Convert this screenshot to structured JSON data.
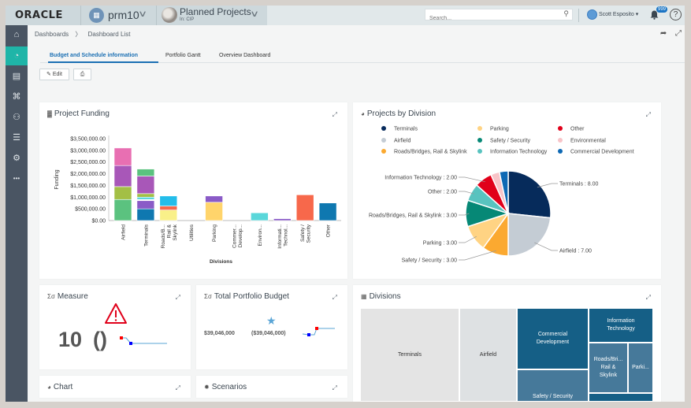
{
  "header": {
    "logo": "ORACLE",
    "workspace": "prm10",
    "project_title": "Planned Projects",
    "project_subtitle": "In: CIP",
    "search_placeholder": "Search...",
    "user_name": "Scott Esposito ▾",
    "notification_count": "999",
    "help_label": "?"
  },
  "sidebar": {
    "items": [
      {
        "name": "home",
        "glyph": "⌂"
      },
      {
        "name": "dashboards",
        "glyph": "◔",
        "active": true
      },
      {
        "name": "projects",
        "glyph": "▤"
      },
      {
        "name": "company",
        "glyph": "⌘"
      },
      {
        "name": "users",
        "glyph": "⚇"
      },
      {
        "name": "documents",
        "glyph": "☰"
      },
      {
        "name": "settings",
        "glyph": "⚙"
      },
      {
        "name": "more",
        "glyph": "•••"
      }
    ]
  },
  "breadcrumb": {
    "items": [
      "Dashboards",
      "〉",
      "Dashboard List"
    ]
  },
  "tabs": [
    {
      "label": "Budget and Schedule information",
      "active": true
    },
    {
      "label": "Portfolio Gantt",
      "active": false
    },
    {
      "label": "Overview Dashboard",
      "active": false
    }
  ],
  "toolbar": {
    "edit_label": "Edit",
    "edit_icon": "✎",
    "print_icon": "⎙"
  },
  "expand_glyph": "⤢",
  "cards": {
    "project_funding": {
      "title": "Project Funding",
      "icon": "▓"
    },
    "projects_by_division": {
      "title": "Projects by Division",
      "icon": "◕"
    },
    "measure": {
      "title": "Measure",
      "icon": "Σσ",
      "value": "10",
      "paren": "()",
      "alert_icon": "⚠"
    },
    "total_portfolio_budget": {
      "title": "Total Portfolio Budget",
      "icon": "Σσ",
      "value": "$39,046,000",
      "variance": "($39,046,000)",
      "star_icon": "★"
    },
    "divisions": {
      "title": "Divisions",
      "icon": "▦"
    },
    "chart": {
      "title": "Chart",
      "icon": "◕"
    },
    "scenarios": {
      "title": "Scenarios",
      "icon": "✹"
    }
  },
  "chart_data": [
    {
      "type": "bar",
      "stacked": true,
      "title": "Project Funding",
      "xlabel": "Divisions",
      "ylabel": "Funding",
      "ylim": [
        0,
        3500000
      ],
      "yticks": [
        "$0.00",
        "$500,000.00",
        "$1,000,000.00",
        "$1,500,000.00",
        "$2,000,000.00",
        "$2,500,000.00",
        "$3,000,000.00",
        "$3,500,000.00"
      ],
      "categories": [
        "Airfield",
        "Terminals",
        "Roads/B... Rail & Skylink",
        "Utilities",
        "Parking",
        "Commer... Develop...",
        "Environ...",
        "Informati... Technol...",
        "Safety / Security",
        "Other"
      ],
      "category_lines": [
        [
          "Airfield"
        ],
        [
          "Terminals"
        ],
        [
          "Roads/B...",
          "Rail &",
          "Skylink"
        ],
        [
          "Utilities"
        ],
        [
          "Parking"
        ],
        [
          "Commer...",
          "Develop..."
        ],
        [
          "Environ..."
        ],
        [
          "Informati...",
          "Technol..."
        ],
        [
          "Safety /",
          "Security"
        ],
        [
          "Other"
        ]
      ],
      "stacks": [
        [
          {
            "value": 900000,
            "color": "#5bc27f"
          },
          {
            "value": 550000,
            "color": "#a3bf45"
          },
          {
            "value": 900000,
            "color": "#a857b8"
          },
          {
            "value": 750000,
            "color": "#e86fb2"
          }
        ],
        [
          {
            "value": 500000,
            "color": "#0f78b0"
          },
          {
            "value": 350000,
            "color": "#8a5bc7"
          },
          {
            "value": 50000,
            "color": "#ffffff"
          },
          {
            "value": 100000,
            "color": "#5ad7da"
          },
          {
            "value": 150000,
            "color": "#a3bf45"
          },
          {
            "value": 750000,
            "color": "#a857b8"
          },
          {
            "value": 300000,
            "color": "#5bc27f"
          }
        ],
        [
          {
            "value": 450000,
            "color": "#f9f089"
          },
          {
            "value": 170000,
            "color": "#f7684b"
          },
          {
            "value": 430000,
            "color": "#24bdea"
          }
        ],
        [],
        [
          {
            "value": 780000,
            "color": "#ffd46b"
          },
          {
            "value": 270000,
            "color": "#8a5bc7"
          }
        ],
        [],
        [
          {
            "value": 330000,
            "color": "#5ad7da"
          }
        ],
        [
          {
            "value": 80000,
            "color": "#8a5bc7"
          }
        ],
        [
          {
            "value": 1100000,
            "color": "#f7684b"
          }
        ],
        [
          {
            "value": 750000,
            "color": "#0f78b0"
          }
        ]
      ]
    },
    {
      "type": "pie",
      "title": "Projects by Division",
      "legend_position": "top",
      "legend": [
        {
          "label": "Terminals",
          "color": "#072b5c"
        },
        {
          "label": "Airfield",
          "color": "#c4ccd4"
        },
        {
          "label": "Roads/Bridges, Rail & Skylink",
          "color": "#fba930"
        },
        {
          "label": "Parking",
          "color": "#ffd383"
        },
        {
          "label": "Safety / Security",
          "color": "#068876"
        },
        {
          "label": "Information Technology",
          "color": "#58c3bf"
        },
        {
          "label": "Other",
          "color": "#e1001a"
        },
        {
          "label": "Environmental",
          "color": "#f8c4c8"
        },
        {
          "label": "Commercial Development",
          "color": "#0e69b4"
        }
      ],
      "slices": [
        {
          "label": "Terminals",
          "value": 8,
          "color": "#062b5b",
          "display": "Terminals : 8.00"
        },
        {
          "label": "Airfield",
          "value": 7,
          "color": "#c4ccd4",
          "display": "Airfield : 7.00"
        },
        {
          "label": "Safety / Security",
          "value": 3,
          "color": "#fba930",
          "display": "Safety / Security : 3.00"
        },
        {
          "label": "Parking",
          "value": 3,
          "color": "#ffd383",
          "display": "Parking : 3.00"
        },
        {
          "label": "Roads/Bridges, Rail & Skylink",
          "value": 3,
          "color": "#068876",
          "display": "Roads/Bridges, Rail & Skylink : 3.00"
        },
        {
          "label": "Other",
          "value": 2,
          "color": "#58c3bf",
          "display": "Other : 2.00"
        },
        {
          "label": "Information Technology",
          "value": 2,
          "color": "#e1001a",
          "display": "Information Technology : 2.00"
        },
        {
          "label": "Environmental",
          "value": 1,
          "color": "#f8c4c8",
          "display": ""
        },
        {
          "label": "Commercial Development",
          "value": 1,
          "color": "#0e69b4",
          "display": ""
        }
      ]
    },
    {
      "type": "treemap",
      "title": "Divisions",
      "cells": [
        {
          "label": "Terminals",
          "color": "#e4e4e4",
          "text": "#333333"
        },
        {
          "label": "Airfield",
          "color": "#dee1e3",
          "text": "#333333"
        },
        {
          "label": "Commercial Development",
          "color": "#155f86",
          "text": "#ffffff"
        },
        {
          "label": "Safety / Security",
          "color": "#46799a",
          "text": "#ffffff"
        },
        {
          "label": "Information Technology",
          "color": "#155f86",
          "text": "#ffffff"
        },
        {
          "label": "Roads/Bri... Rail & Skylink",
          "color": "#46799a",
          "text": "#ffffff"
        },
        {
          "label": "Parki...",
          "color": "#46799a",
          "text": "#ffffff"
        }
      ]
    }
  ],
  "sparkline_colors": {
    "line": "#5aa5d6",
    "high": "#ff0000",
    "low": "#0000ff"
  },
  "accent_color": "#1a6fb3",
  "sidebar_active_color": "#1fb5a8"
}
